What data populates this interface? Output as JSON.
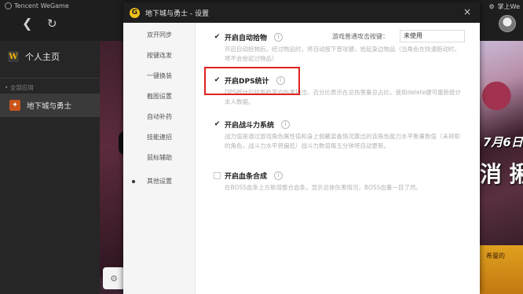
{
  "wegame": {
    "brand": "Tencent WeGame",
    "user_short": "掌上We",
    "home_label": "个人主页",
    "apps_label": "全部应用",
    "game_item": "地下城与勇士",
    "banner_date": "7月6日",
    "banner_big": "消 揪",
    "banner_footer": "希曼的"
  },
  "dialog": {
    "title": "地下城与勇士 - 设置",
    "close_icon": "×",
    "nav": [
      {
        "label": "双开同步"
      },
      {
        "label": "按键连发"
      },
      {
        "label": "一键换装"
      },
      {
        "label": "截图设置"
      },
      {
        "label": "自动补药"
      },
      {
        "label": "技能連招"
      },
      {
        "label": "鼠标辅助"
      },
      {
        "label": "其他设置",
        "active": true
      }
    ],
    "options": [
      {
        "title": "开启自动拾物",
        "checked": true,
        "desc": "开启自动拾物后，经过物品时，将自动按下普攻键，拾起身边物品（当角色在快速跑动时，将不会拾起过物品）",
        "key_label": "游戏普通攻击按键：",
        "key_value": "未使用"
      },
      {
        "title": "开启DPS统计",
        "checked": true,
        "desc": "DPS统计包括每秒平均伤害输出，百分比表示在总伤害量总占比，使用delete键可重新统计本人数据。"
      },
      {
        "title": "开启战斗力系统",
        "checked": true,
        "desc": "战力值是通过游戏角色属性值和身上佩戴装备情况算出的该角色能力水平衡量数值（未转职的角色，战斗力水平将偏低）战斗力数值每五分钟将自动更新。"
      },
      {
        "title": "开启血条合成",
        "checked": false,
        "desc": "在BOSS血条上方新增整合血条，显示总体伤害情况，BOSS血量一目了然。"
      }
    ],
    "info_icon": "i",
    "check_mark": "✔"
  },
  "colors": {
    "highlight": "#e02121",
    "title_bar": "#1f1f1f",
    "brand_yellow": "#f3c21a"
  }
}
